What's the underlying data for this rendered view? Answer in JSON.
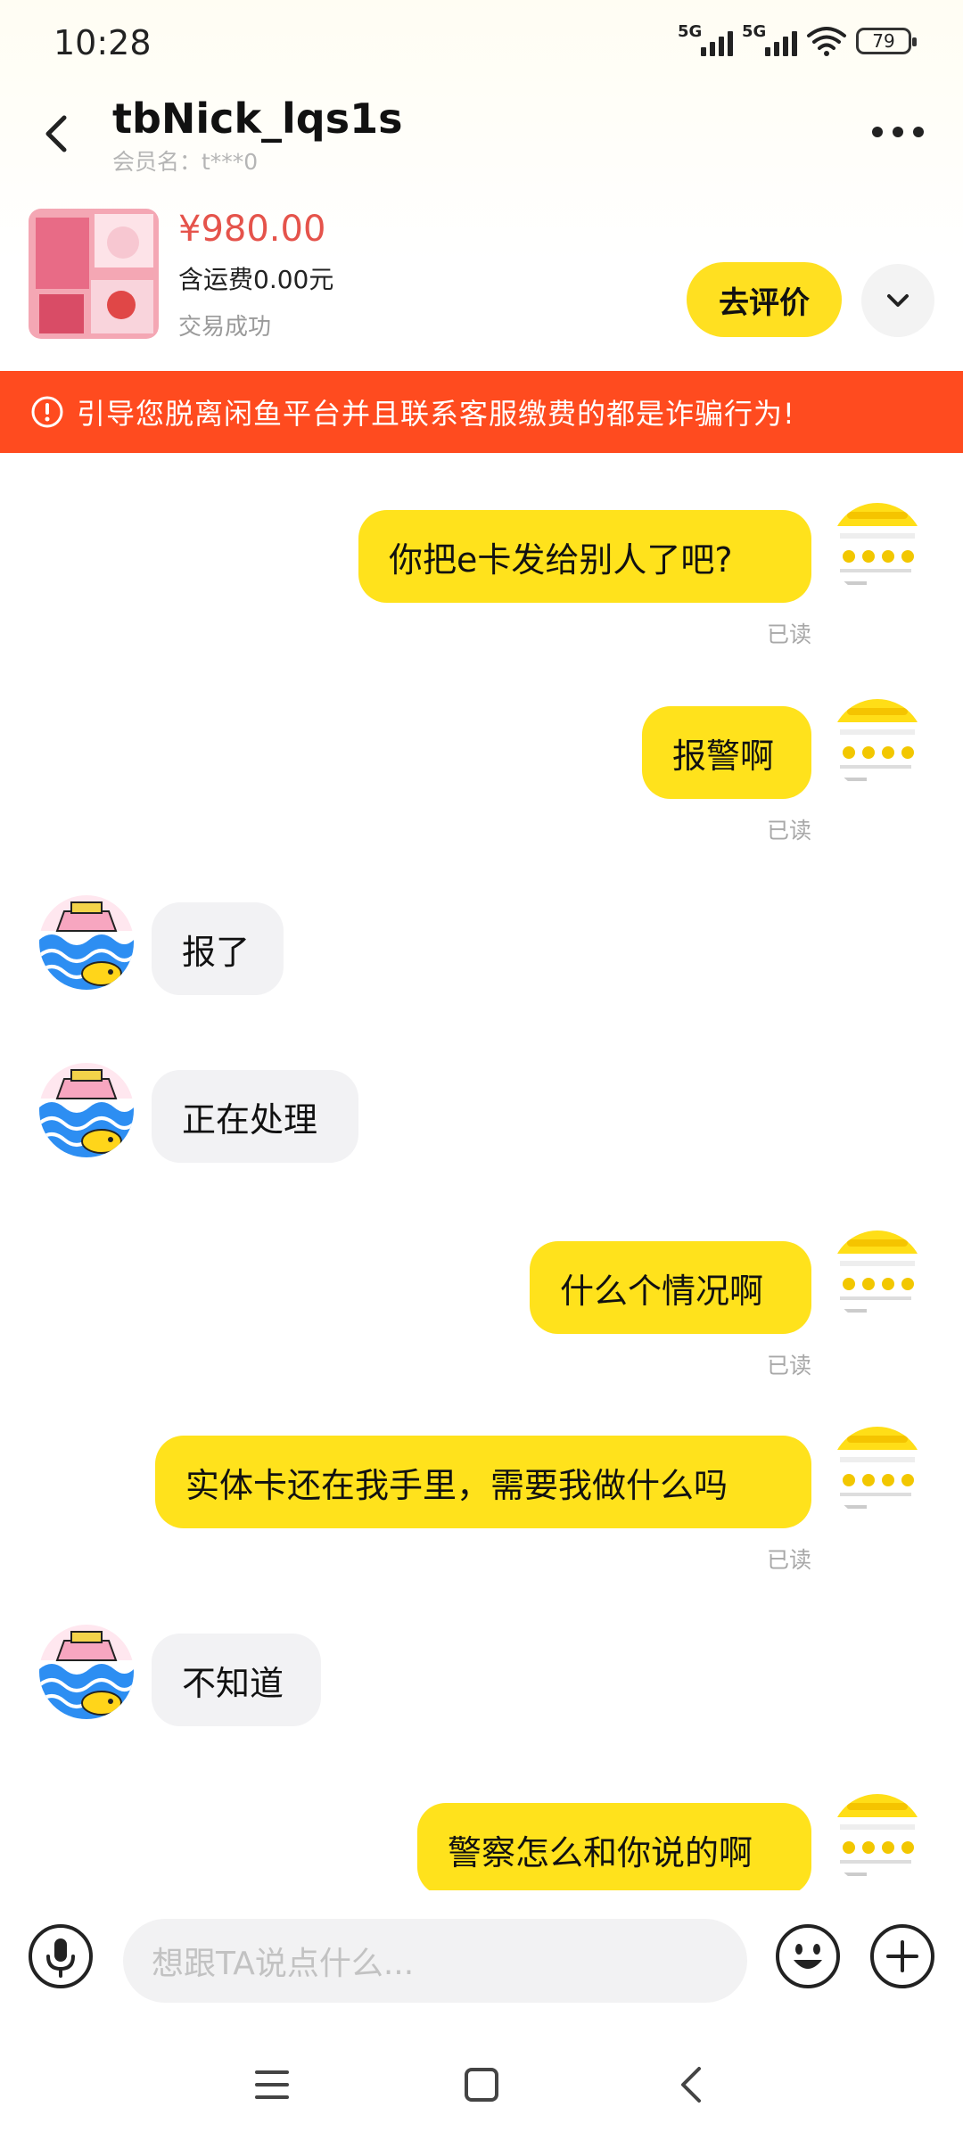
{
  "status_bar": {
    "time": "10:28",
    "signal1_label": "5G",
    "signal2_label": "5G",
    "battery": "79"
  },
  "header": {
    "title": "tbNick_lqs1s",
    "member_name": "会员名：t***0"
  },
  "product": {
    "price": "¥980.00",
    "shipping": "含运费0.00元",
    "status": "交易成功",
    "review_button": "去评价"
  },
  "warning": {
    "text": "引导您脱离闲鱼平台并且联系客服缴费的都是诈骗行为!"
  },
  "messages": [
    {
      "sender": "me",
      "text": "你把e卡发给别人了吧?",
      "read": "已读"
    },
    {
      "sender": "me",
      "text": "报警啊",
      "read": "已读"
    },
    {
      "sender": "them",
      "text": "报了"
    },
    {
      "sender": "them",
      "text": "正在处理"
    },
    {
      "sender": "me",
      "text": "什么个情况啊",
      "read": "已读"
    },
    {
      "sender": "me",
      "text": "实体卡还在我手里，需要我做什么吗",
      "read": "已读"
    },
    {
      "sender": "them",
      "text": "不知道"
    },
    {
      "sender": "me",
      "text": "警察怎么和你说的啊"
    }
  ],
  "input": {
    "placeholder": "想跟TA说点什么..."
  },
  "icons": {
    "back": "back-arrow-icon",
    "more": "more-dots-icon",
    "expand": "chevron-down-icon",
    "warning": "alert-circle-icon",
    "mic": "microphone-icon",
    "emoji": "emoji-icon",
    "plus": "plus-icon"
  },
  "colors": {
    "accent_yellow": "#ffe21c",
    "warning_bg": "#ff4b1f",
    "price_red": "#e5534b"
  }
}
